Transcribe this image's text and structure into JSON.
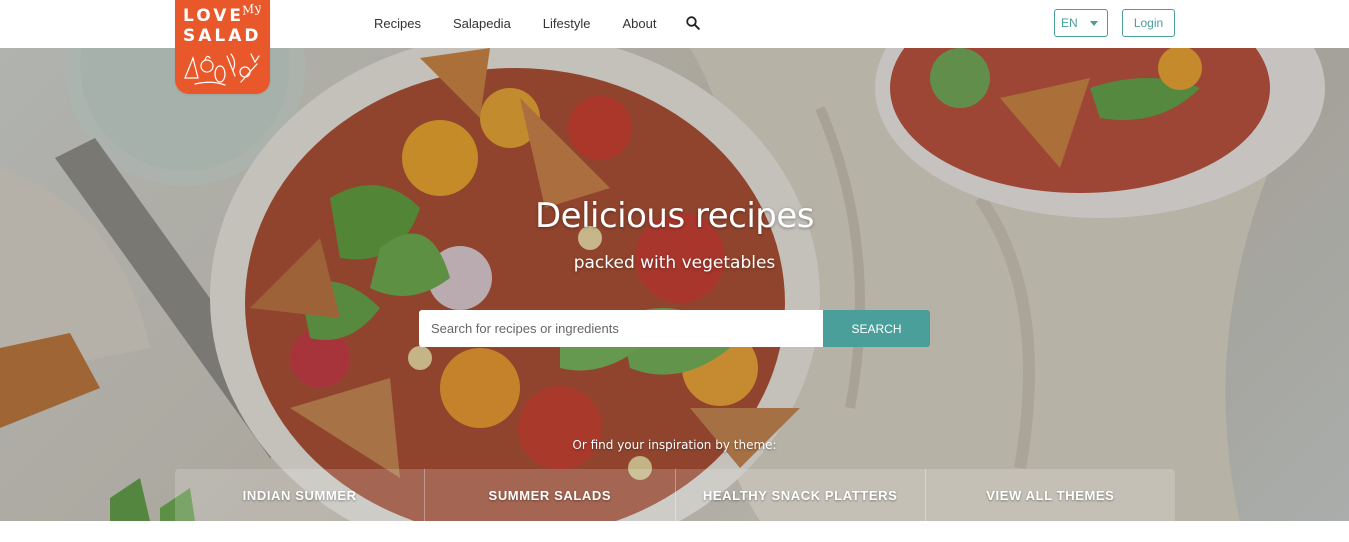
{
  "logo": {
    "line1": "LOVE",
    "line2": "SALAD",
    "script": "My"
  },
  "nav": {
    "items": [
      "Recipes",
      "Salapedia",
      "Lifestyle",
      "About"
    ],
    "search_icon": "search-icon"
  },
  "language": {
    "selected": "EN",
    "icon": "chevron-down-icon"
  },
  "login_label": "Login",
  "hero": {
    "title": "Delicious recipes",
    "subtitle": "packed with vegetables",
    "search_placeholder": "Search for recipes or ingredients",
    "search_button": "SEARCH",
    "theme_hint": "Or find your inspiration by theme:"
  },
  "themes": [
    "INDIAN SUMMER",
    "SUMMER SALADS",
    "HEALTHY SNACK PLATTERS",
    "VIEW ALL THEMES"
  ],
  "colors": {
    "brand": "#e8582a",
    "accent": "#4a9f9a"
  }
}
